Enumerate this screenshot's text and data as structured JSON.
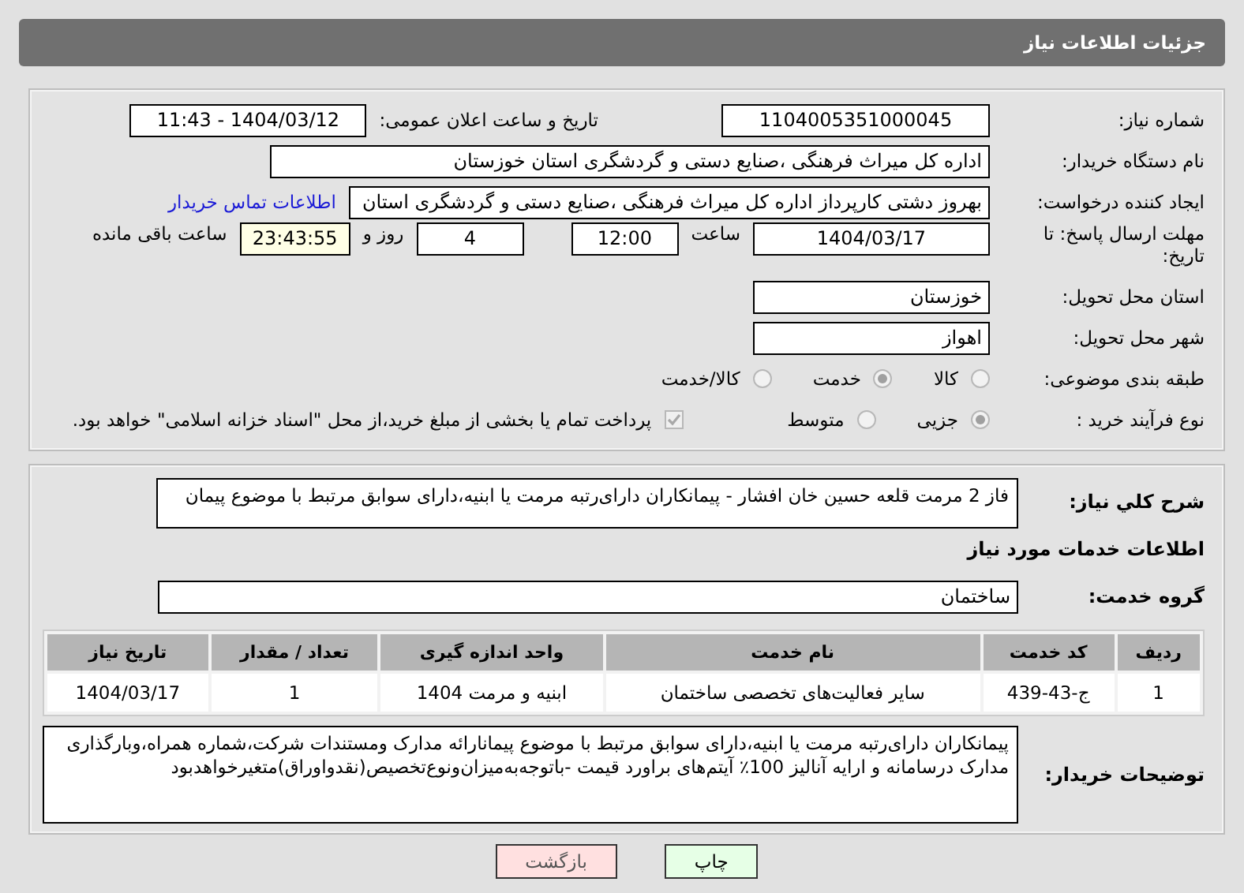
{
  "header": {
    "title": "جزئیات اطلاعات نیاز"
  },
  "details": {
    "need_number": {
      "label": "شماره نیاز:",
      "value": "1104005351000045"
    },
    "announce": {
      "label": "تاریخ و ساعت اعلان عمومی:",
      "value": "1404/03/12 - 11:43"
    },
    "buyer": {
      "label": "نام دستگاه خریدار:",
      "value": "اداره کل میراث فرهنگی ،صنایع دستی و گردشگری استان خوزستان"
    },
    "creator": {
      "label": "ایجاد کننده درخواست:",
      "value": "بهروز دشتی کارپرداز اداره کل میراث فرهنگی ،صنایع دستی و گردشگری استان",
      "link": "اطلاعات تماس خریدار"
    },
    "deadline": {
      "label": "مهلت ارسال پاسخ: تا تاریخ:",
      "date": "1404/03/17",
      "time_label": "ساعت",
      "time": "12:00",
      "days": "4",
      "days_label": "روز و",
      "remaining": "23:43:55",
      "remaining_label": "ساعت باقی مانده"
    },
    "province": {
      "label": "استان محل تحویل:",
      "value": "خوزستان"
    },
    "city": {
      "label": "شهر محل تحویل:",
      "value": "اهواز"
    },
    "category": {
      "label": "طبقه بندی موضوعی:",
      "options": [
        {
          "label": "کالا",
          "selected": false
        },
        {
          "label": "خدمت",
          "selected": true
        },
        {
          "label": "کالا/خدمت",
          "selected": false
        }
      ]
    },
    "process": {
      "label": "نوع فرآیند خرید :",
      "options": [
        {
          "label": "جزیی",
          "selected": true
        },
        {
          "label": "متوسط",
          "selected": false
        }
      ],
      "payment": {
        "checked": true,
        "text": "پرداخت تمام یا بخشی از مبلغ خرید،از محل \"اسناد خزانه اسلامی\" خواهد بود."
      }
    }
  },
  "description": {
    "label": "شرح کلي نیاز:",
    "value": "فاز 2 مرمت قلعه حسین خان افشار -  پیمانکاران دارای‌رتبه مرمت یا ابنیه،دارای سوابق مرتبط با موضوع پیمان"
  },
  "services": {
    "heading": "اطلاعات خدمات مورد نیاز",
    "group_label": "گروه خدمت:",
    "group": "ساختمان",
    "table": {
      "columns": [
        "ردیف",
        "کد خدمت",
        "نام خدمت",
        "واحد اندازه گیری",
        "تعداد / مقدار",
        "تاریخ نیاز"
      ],
      "rows": [
        [
          "1",
          "ج-43-439",
          "سایر فعالیت‌های تخصصی ساختمان",
          "ابنیه و مرمت 1404",
          "1",
          "1404/03/17"
        ]
      ]
    }
  },
  "notes": {
    "label": "توضیحات خریدار:",
    "value": "پیمانکاران دارای‌رتبه مرمت یا ابنیه،دارای سوابق مرتبط با موضوع پیمانارائه مدارک ومستندات شرکت،شماره همراه،وبارگذاری مدارک درسامانه و ارایه آنالیز 100٪ آیتم‌های براورد قیمت -باتوجه‌به‌میزان‌ونوع‌تخصیص(نقدواوراق)متغیرخواهدبود"
  },
  "buttons": [
    {
      "label": "چاپ",
      "kind": "print"
    },
    {
      "label": "بازگشت",
      "kind": "back"
    }
  ]
}
